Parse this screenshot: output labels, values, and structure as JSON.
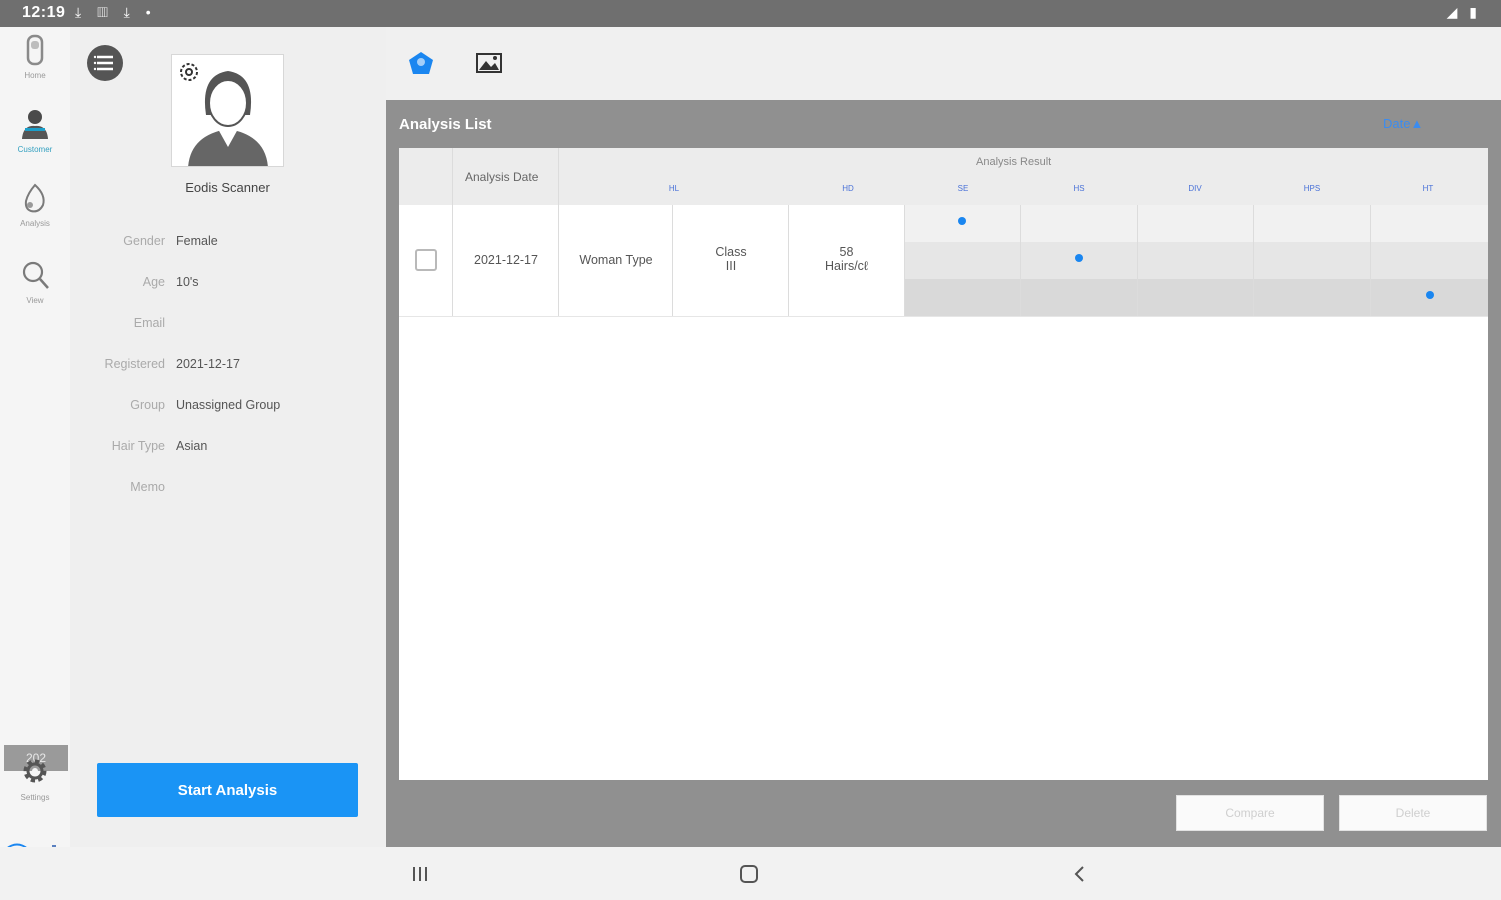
{
  "status_bar": {
    "time": "12:19",
    "left_icons": "⤓ ▥ ⤓ •",
    "right_icons": "◢ ▮"
  },
  "rail": {
    "items": [
      {
        "label": "Home",
        "icon": "scanner-icon",
        "active": false
      },
      {
        "label": "Customer",
        "icon": "customer-icon",
        "active": true
      },
      {
        "label": "Analysis",
        "icon": "analysis-icon",
        "active": false
      },
      {
        "label": "View",
        "icon": "magnifier-icon",
        "active": false
      }
    ],
    "version": "202",
    "settings_label": "Settings"
  },
  "profile": {
    "name": "Eodis Scanner",
    "fields": [
      {
        "key": "Gender",
        "value": "Female"
      },
      {
        "key": "Age",
        "value": "10's"
      },
      {
        "key": "Email",
        "value": ""
      },
      {
        "key": "Registered",
        "value": "2021-12-17"
      },
      {
        "key": "Group",
        "value": "Unassigned Group"
      },
      {
        "key": "Hair Type",
        "value": "Asian"
      },
      {
        "key": "Memo",
        "value": ""
      }
    ],
    "start_button": "Start Analysis"
  },
  "analysis_list": {
    "title": "Analysis List",
    "sort_label": "Date▲",
    "headers": {
      "date": "Analysis Date",
      "result": "Analysis Result",
      "metrics": [
        "HL",
        "HD",
        "SE",
        "HS",
        "DIV",
        "HPS",
        "HT"
      ]
    },
    "rows": [
      {
        "date": "2021-12-17",
        "type": "Woman Type",
        "class_label": "Class",
        "class_value": "III",
        "density_value": "58",
        "density_unit": "Hairs/cℓ",
        "dot_levels": [
          1,
          2,
          0,
          0,
          3
        ]
      }
    ],
    "compare_button": "Compare",
    "delete_button": "Delete"
  },
  "colors": {
    "accent": "#1a94f5",
    "panel": "#909090",
    "dot": "#1a86f0"
  }
}
